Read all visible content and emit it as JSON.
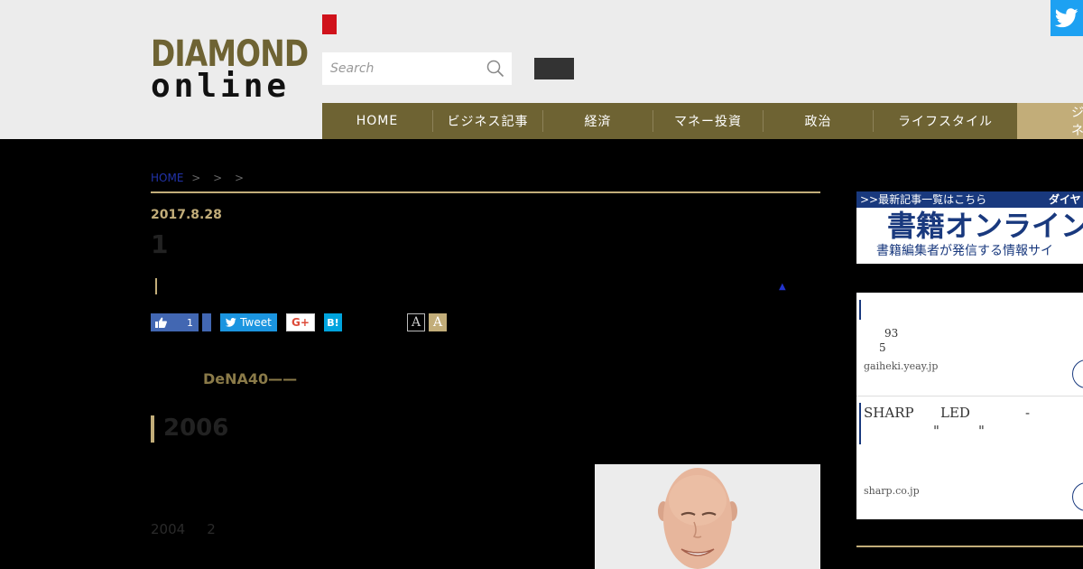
{
  "header": {
    "logo_line1": "DIAMOND",
    "logo_line2": "online",
    "search_placeholder": "Search",
    "twitter_icon": "twitter-icon"
  },
  "nav": {
    "items": [
      "HOME",
      "ビジネス記事",
      "経済",
      "マネー投資",
      "政治",
      "ライフスタイル"
    ],
    "last_item": "ビジネス"
  },
  "breadcrumb": {
    "home": "HOME",
    "separators": [
      ">",
      ">",
      ">"
    ]
  },
  "article": {
    "date": "2017.8.28",
    "title": "1",
    "up_arrow": "▲",
    "social": {
      "fb_like_count": "1",
      "tweet_label": "Tweet",
      "gplus_label": "G+",
      "hatena_label": "B!"
    },
    "font_small": "A",
    "font_large": "A",
    "lead": "DeNA40——",
    "section_title": "2006",
    "body_year": "2004",
    "body_num": "2"
  },
  "sidebar": {
    "banner": {
      "top_text": ">>最新記事一覧はこちら",
      "top_right": "ダイヤ",
      "main": "書籍オンライン",
      "sub": "書籍編集者が発信する情報サイ"
    },
    "ads": [
      {
        "line1": "93",
        "line2": "5",
        "source": "gaiheki.yeay.jp"
      },
      {
        "brand": "SHARP",
        "product": "LED",
        "dash": "-",
        "quote_open": "\"",
        "quote_close": "\"",
        "source": "sharp.co.jp"
      }
    ]
  },
  "colors": {
    "brand": "#6e6333",
    "accent_gold": "#c2ad79",
    "link_blue": "#2233aa"
  }
}
